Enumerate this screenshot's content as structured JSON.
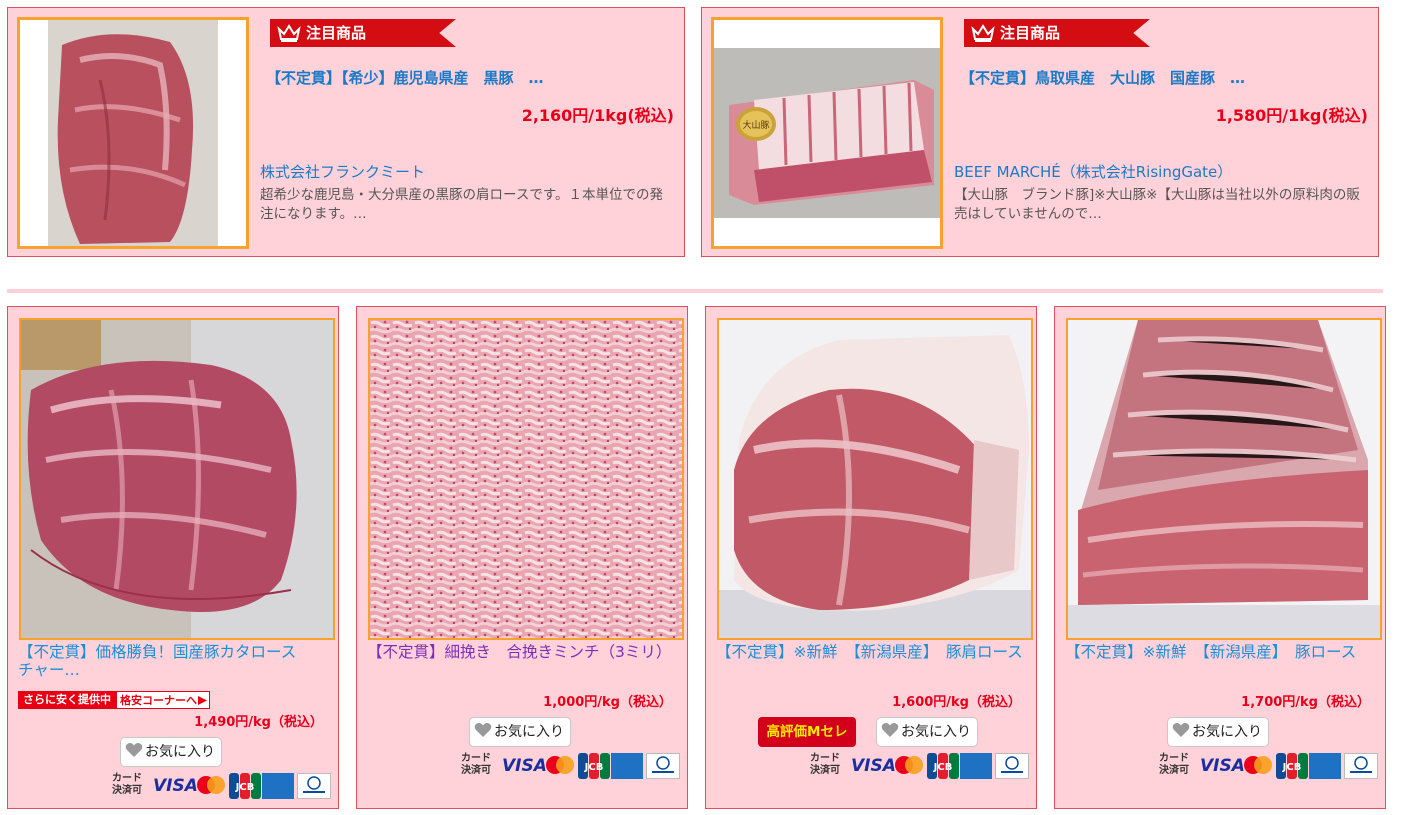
{
  "featured": [
    {
      "ribbon": "注目商品",
      "title": "【不定貫】【希少】鹿児島県産　黒豚　…",
      "price": "2,160円/1kg(税込)",
      "shop": "株式会社フランクミート",
      "desc": "超希少な鹿児島・大分県産の黒豚の肩ロースです。１本単位での発注になります。…"
    },
    {
      "ribbon": "注目商品",
      "title": "【不定貫】鳥取県産　大山豚　国産豚　…",
      "price": "1,580円/1kg(税込)",
      "shop": "BEEF MARCHÉ（株式会社RisingGate）",
      "desc": "【大山豚　ブランド豚]※大山豚※【大山豚は当社以外の原料肉の販売はしていませんので…",
      "package_label": "大山豚"
    }
  ],
  "products": [
    {
      "title": "【不定貫】価格勝負！国産豚カタロース　チャー…",
      "bargain_left": "さらに安く提供中",
      "bargain_right": "格安コーナーへ",
      "price": "1,490円/kg（税込）",
      "favorite": "お気に入り"
    },
    {
      "title": "【不定貫】細挽き　合挽きミンチ（3ミリ）",
      "price": "1,000円/kg（税込）",
      "favorite": "お気に入り"
    },
    {
      "title": "【不定貫】※新鮮　【新潟県産】　豚肩ロース",
      "price": "1,600円/kg（税込）",
      "badge": "高評価Mセレ",
      "favorite": "お気に入り"
    },
    {
      "title": "【不定貫】※新鮮　【新潟県産】　豚ロース",
      "price": "1,700円/kg（税込）",
      "favorite": "お気に入り"
    }
  ],
  "payment": {
    "label_line1": "カード",
    "label_line2": "決済可",
    "visa": "VISA",
    "card_logos": [
      "mastercard-icon",
      "jcb-icon",
      "amex-icon",
      "diners-club-icon"
    ]
  },
  "colors": {
    "card_bg": "#ffd2da",
    "card_border": "#e05060",
    "image_border": "#f7a22c",
    "ribbon_red": "#d40d12",
    "price_red": "#e6001a",
    "link_blue": "#1a8fd6",
    "visited_purple": "#7b2fb8"
  }
}
